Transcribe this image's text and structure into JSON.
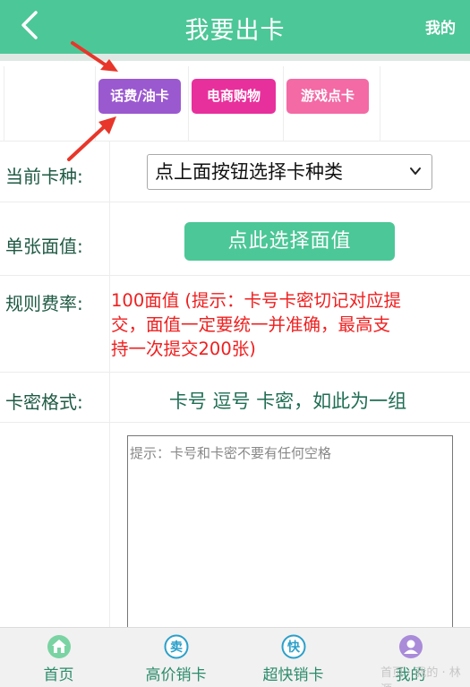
{
  "header": {
    "title": "我要出卡",
    "mine_label": "我的"
  },
  "categories": [
    {
      "label": "话费/油卡",
      "color": "#9b59d0"
    },
    {
      "label": "电商购物",
      "color": "#e8309c"
    },
    {
      "label": "游戏点卡",
      "color": "#f36aa5"
    }
  ],
  "form": {
    "card_type_label": "当前卡种:",
    "card_type_select": "点上面按钮选择卡种类",
    "face_value_label": "单张面值:",
    "face_value_button": "点此选择面值",
    "rate_label": "规则费率:",
    "rate_text": "100面值 (提示：卡号卡密切记对应提交，面值一定要统一并准确，最高支持一次提交200张)",
    "format_label": "卡密格式:",
    "format_text": "卡号 逗号 卡密，如此为一组",
    "textarea_placeholder": "提示：卡号和卡密不要有任何空格"
  },
  "bottom_nav": [
    {
      "label": "首页",
      "icon": "home-icon"
    },
    {
      "label": "高价销卡",
      "icon": "sell-icon",
      "icon_glyph": "卖"
    },
    {
      "label": "超快销卡",
      "icon": "fast-icon",
      "icon_glyph": "快"
    },
    {
      "label": "我的",
      "icon": "user-icon"
    }
  ],
  "watermark": "首页 · 我的 · 林源",
  "colors": {
    "primary": "#4cc797",
    "rate_text": "#ef1f1f",
    "arrow": "#e8362a"
  }
}
